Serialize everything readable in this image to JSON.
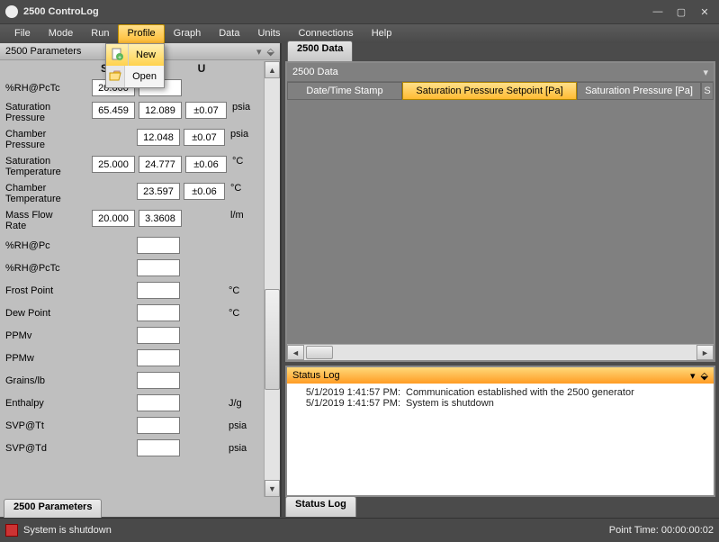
{
  "window": {
    "title": "2500 ControLog"
  },
  "menus": {
    "file": "File",
    "mode": "Mode",
    "run": "Run",
    "profile": "Profile",
    "graph": "Graph",
    "data": "Data",
    "units": "Units",
    "connections": "Connections",
    "help": "Help"
  },
  "profile_menu": {
    "new": "New",
    "open": "Open"
  },
  "params_panel": {
    "title": "2500 Parameters",
    "hdr_setp": "Setp",
    "hdr_u": "U",
    "rows": {
      "rhpctc": {
        "label": "%RH@PcTc",
        "set": "20.000",
        "val": "",
        "tol": "",
        "unit": ""
      },
      "satpress": {
        "label": "Saturation\nPressure",
        "set": "65.459",
        "val": "12.089",
        "tol": "±0.07",
        "unit": "psia"
      },
      "chpress": {
        "label": "Chamber\nPressure",
        "set": "",
        "val": "12.048",
        "tol": "±0.07",
        "unit": "psia"
      },
      "sattemp": {
        "label": "Saturation\nTemperature",
        "set": "25.000",
        "val": "24.777",
        "tol": "±0.06",
        "unit": "°C"
      },
      "chtemp": {
        "label": "Chamber\nTemperature",
        "set": "",
        "val": "23.597",
        "tol": "±0.06",
        "unit": "°C"
      },
      "mfr": {
        "label": "Mass Flow\nRate",
        "set": "20.000",
        "val": "3.3608",
        "tol": "",
        "unit": "l/m"
      },
      "rhpc": {
        "label": "%RH@Pc",
        "val": "",
        "unit": ""
      },
      "rhpctc2": {
        "label": "%RH@PcTc",
        "val": "",
        "unit": ""
      },
      "frost": {
        "label": "Frost Point",
        "val": "",
        "unit": "°C"
      },
      "dew": {
        "label": "Dew Point",
        "val": "",
        "unit": "°C"
      },
      "ppmv": {
        "label": "PPMv",
        "val": "",
        "unit": ""
      },
      "ppmw": {
        "label": "PPMw",
        "val": "",
        "unit": ""
      },
      "grains": {
        "label": "Grains/lb",
        "val": "",
        "unit": ""
      },
      "enthalpy": {
        "label": "Enthalpy",
        "val": "",
        "unit": "J/g"
      },
      "svptt": {
        "label": "SVP@Tt",
        "val": "",
        "unit": "psia"
      },
      "svptd": {
        "label": "SVP@Td",
        "val": "",
        "unit": "psia"
      }
    },
    "tab_label": "2500 Parameters"
  },
  "data_panel": {
    "tab_label": "2500 Data",
    "title": "2500 Data",
    "cols": {
      "c1": "Date/Time Stamp",
      "c2": "Saturation Pressure Setpoint [Pa]",
      "c3": "Saturation Pressure [Pa]",
      "more": "S"
    }
  },
  "status_log": {
    "title": "Status Log",
    "tab_label": "Status Log",
    "entries": [
      {
        "ts": "5/1/2019 1:41:57 PM:",
        "msg": "Communication established with the 2500 generator"
      },
      {
        "ts": "5/1/2019 1:41:57 PM:",
        "msg": "System is shutdown"
      }
    ]
  },
  "statusbar": {
    "status": "System is shutdown",
    "point_time_label": "Point Time:",
    "point_time_value": "00:00:00:02"
  }
}
